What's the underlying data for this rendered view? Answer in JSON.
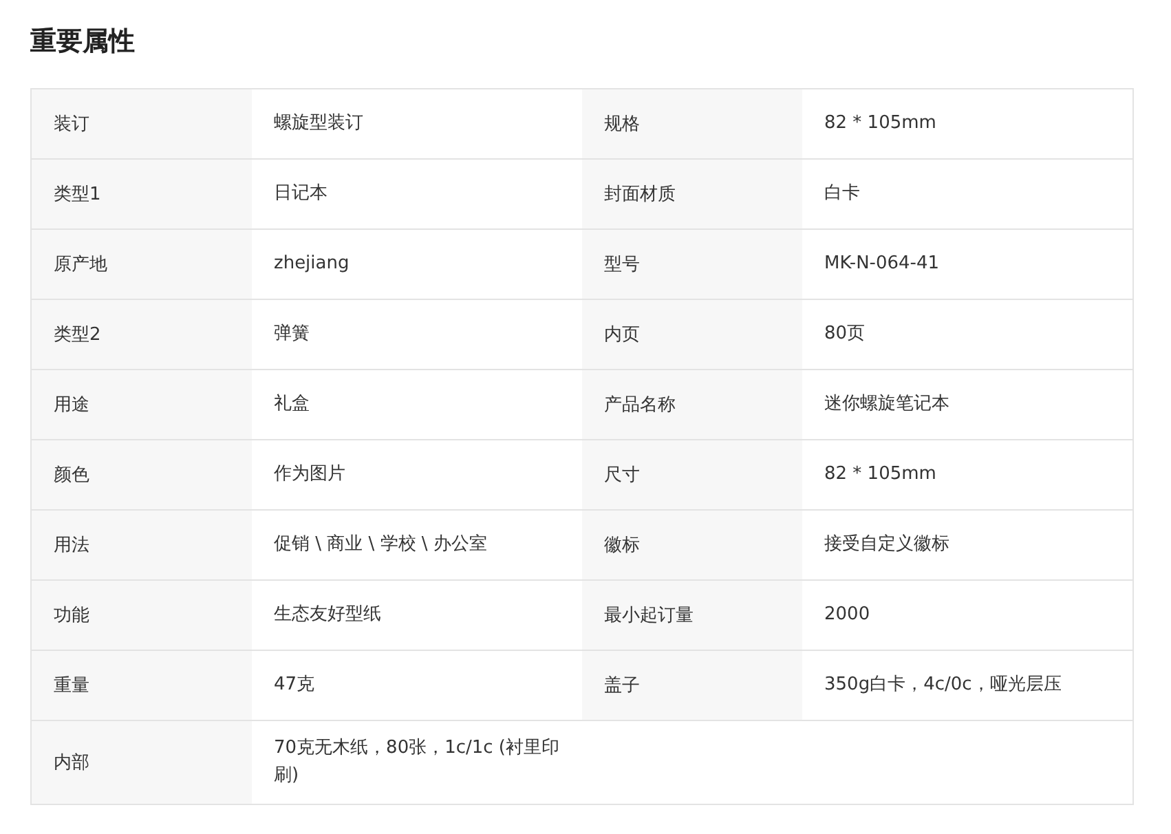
{
  "title": "重要属性",
  "rows": [
    [
      {
        "label": "装订",
        "value": "螺旋型装订"
      },
      {
        "label": "规格",
        "value": "82 * 105mm"
      }
    ],
    [
      {
        "label": "类型1",
        "value": "日记本"
      },
      {
        "label": "封面材质",
        "value": "白卡"
      }
    ],
    [
      {
        "label": "原产地",
        "value": "zhejiang"
      },
      {
        "label": "型号",
        "value": "MK-N-064-41"
      }
    ],
    [
      {
        "label": "类型2",
        "value": "弹簧"
      },
      {
        "label": "内页",
        "value": "80页"
      }
    ],
    [
      {
        "label": "用途",
        "value": "礼盒"
      },
      {
        "label": "产品名称",
        "value": "迷你螺旋笔记本"
      }
    ],
    [
      {
        "label": "颜色",
        "value": "作为图片"
      },
      {
        "label": "尺寸",
        "value": "82 * 105mm"
      }
    ],
    [
      {
        "label": "用法",
        "value": "促销 \\ 商业 \\ 学校 \\ 办公室"
      },
      {
        "label": "徽标",
        "value": "接受自定义徽标"
      }
    ],
    [
      {
        "label": "功能",
        "value": "生态友好型纸"
      },
      {
        "label": "最小起订量",
        "value": "2000"
      }
    ],
    [
      {
        "label": "重量",
        "value": "47克"
      },
      {
        "label": "盖子",
        "value": "350g白卡，4c/0c，哑光层压"
      }
    ],
    [
      {
        "label": "内部",
        "value": "70克无木纸，80张，1c/1c (衬里印刷)"
      }
    ]
  ]
}
